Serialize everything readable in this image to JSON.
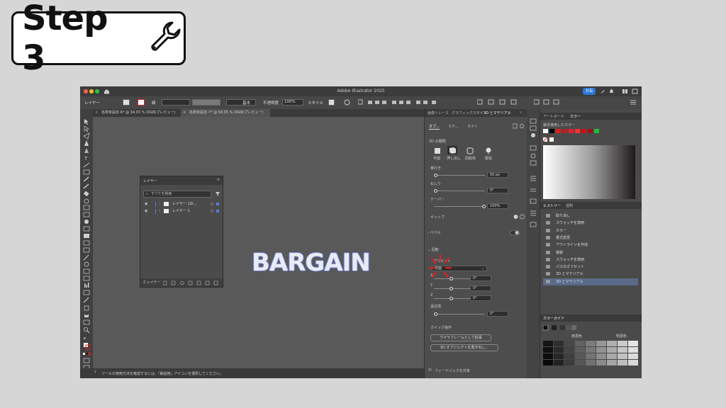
{
  "step_badge": {
    "text": "Step 3",
    "icon": "wrench-icon"
  },
  "app": {
    "title": "Adobe Illustrator 2025",
    "share_label": "共有",
    "colors": {
      "accent": "#2a77d9",
      "highlight_red": "#e0201e",
      "bargain_outline": "#6f82d8"
    }
  },
  "optionbar": {
    "layer_label": "レイヤー",
    "stroke_label": "線",
    "stroke_profile": "基本",
    "opacity_label": "不透明度",
    "opacity_value": "100%",
    "style_label": "スタイル"
  },
  "document_tabs": [
    {
      "label": "名称未設定-6* @ 34.03 % (RGB/プレビュー)"
    },
    {
      "label": "名称未設定-7* @ 58.05 % (RGB/プレビュー)"
    }
  ],
  "canvas": {
    "artwork_text": "BARGAIN"
  },
  "status": {
    "message": "ツールの使用方法を確認するには、「解説用」アイコンを選択してください。"
  },
  "layers_panel": {
    "title": "レイヤー",
    "search_placeholder": "すべてを検索",
    "layers": [
      {
        "name": "レイヤー 1の..."
      },
      {
        "name": "レイヤー 1"
      }
    ],
    "footer_count": "2 レイヤー"
  },
  "properties_panel": {
    "tabs": [
      "画像トレース",
      "グラフィックスタイ",
      "3D とマテリアル"
    ],
    "subtabs": [
      "オブ...",
      "マテ...",
      "ライト"
    ],
    "section_3d_type": "3D の種類",
    "types": [
      "平面",
      "押し出し",
      "回転体",
      "膨張"
    ],
    "depth_label": "奥行き",
    "depth_value": "50 px",
    "twist_label": "ねじり",
    "twist_value": "0°",
    "taper_label": "テーパー",
    "taper_value": "100%",
    "cap_label": "キャップ",
    "bevel_label": "ベベル",
    "rotation_label": "回転",
    "preset_label": "プリセット",
    "preset_value": "前面",
    "axes": [
      {
        "axis": "X",
        "value": "0°"
      },
      {
        "axis": "Y",
        "value": "0°"
      },
      {
        "axis": "Z",
        "value": "0°"
      }
    ],
    "perspective_label": "遠近感",
    "perspective_value": "0°",
    "quick_actions_label": "クイック操作",
    "action_buttons": [
      "ワイヤフレームとして拡張",
      "3D オブジェクトを書き出し..."
    ],
    "feedback_label": "フィードバックを共有"
  },
  "color_panel": {
    "tabs": [
      "アートボード",
      "カラー"
    ],
    "recent_label": "最近使用したカラー",
    "swatches": [
      "#ffffff",
      "#000000",
      "#e41d1d",
      "#b81d1d",
      "#e8202a",
      "#ff3030",
      "#d01010",
      "#a01020",
      "#1dbd30"
    ]
  },
  "history_panel": {
    "tabs": [
      "ヒストリー",
      "透明"
    ],
    "items": [
      "取り消し",
      "スウォッチを適用",
      "カラー",
      "書式変更",
      "アウトラインを作成",
      "複製",
      "スウォッチを適用",
      "パスのオフセット",
      "3D とマテリアル",
      "3D とマテリアル"
    ]
  },
  "color_guide_panel": {
    "title": "カラーガイド",
    "shade_label": "暗濃色",
    "tint_label": "明濃色"
  }
}
